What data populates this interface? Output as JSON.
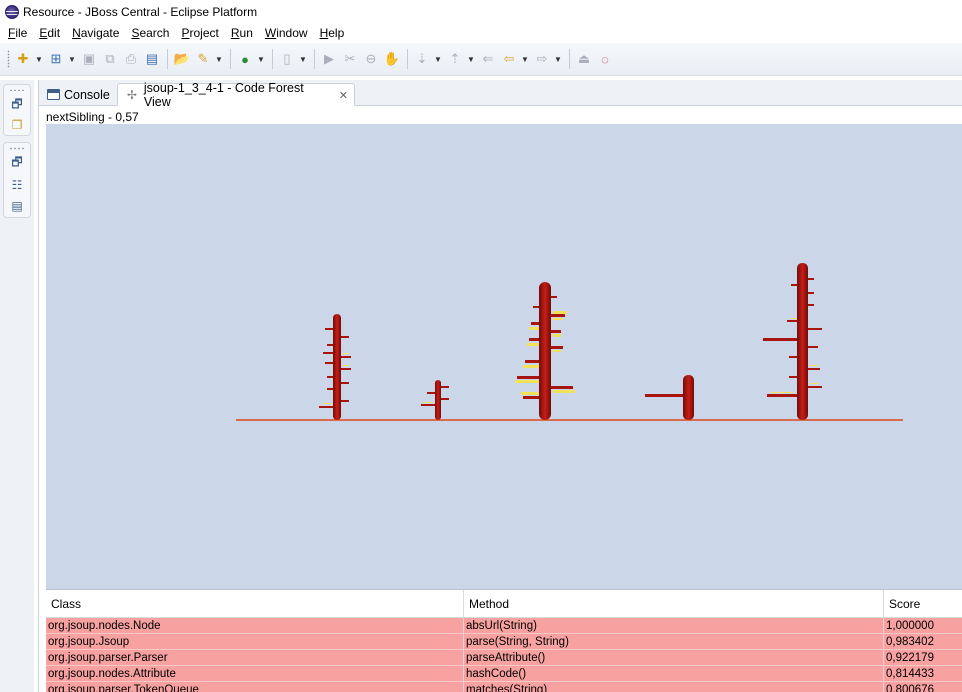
{
  "window": {
    "title": "Resource - JBoss Central - Eclipse Platform"
  },
  "menu": [
    {
      "label": "File"
    },
    {
      "label": "Edit"
    },
    {
      "label": "Navigate"
    },
    {
      "label": "Search"
    },
    {
      "label": "Project"
    },
    {
      "label": "Run"
    },
    {
      "label": "Window"
    },
    {
      "label": "Help"
    }
  ],
  "tabs": {
    "console": "Console",
    "forest": "jsoup-1_3_4-1 - Code Forest View"
  },
  "status": "nextSibling - 0,57",
  "colors": {
    "canvas_bg": "#cbd6e9",
    "trunk": "#a8150f",
    "highlight": "#f3e15a",
    "ground": "#d86c4c",
    "row_bg": "#f7a1a1"
  },
  "table": {
    "headers": [
      "Class",
      "Method",
      "Score"
    ],
    "rows": [
      [
        "org.jsoup.nodes.Node",
        "absUrl(String)",
        "1,000000"
      ],
      [
        "org.jsoup.Jsoup",
        "parse(String, String)",
        "0,983402"
      ],
      [
        "org.jsoup.parser.Parser",
        "parseAttribute()",
        "0,922179"
      ],
      [
        "org.jsoup.nodes.Attribute",
        "hashCode()",
        "0,814433"
      ],
      [
        "org.jsoup.parser.TokenQueue",
        "matches(String)",
        "0,800676"
      ]
    ]
  },
  "trim_icons": [
    "restore-icon",
    "folder-icon",
    "restore-icon",
    "outline-icon",
    "task-list-icon"
  ]
}
